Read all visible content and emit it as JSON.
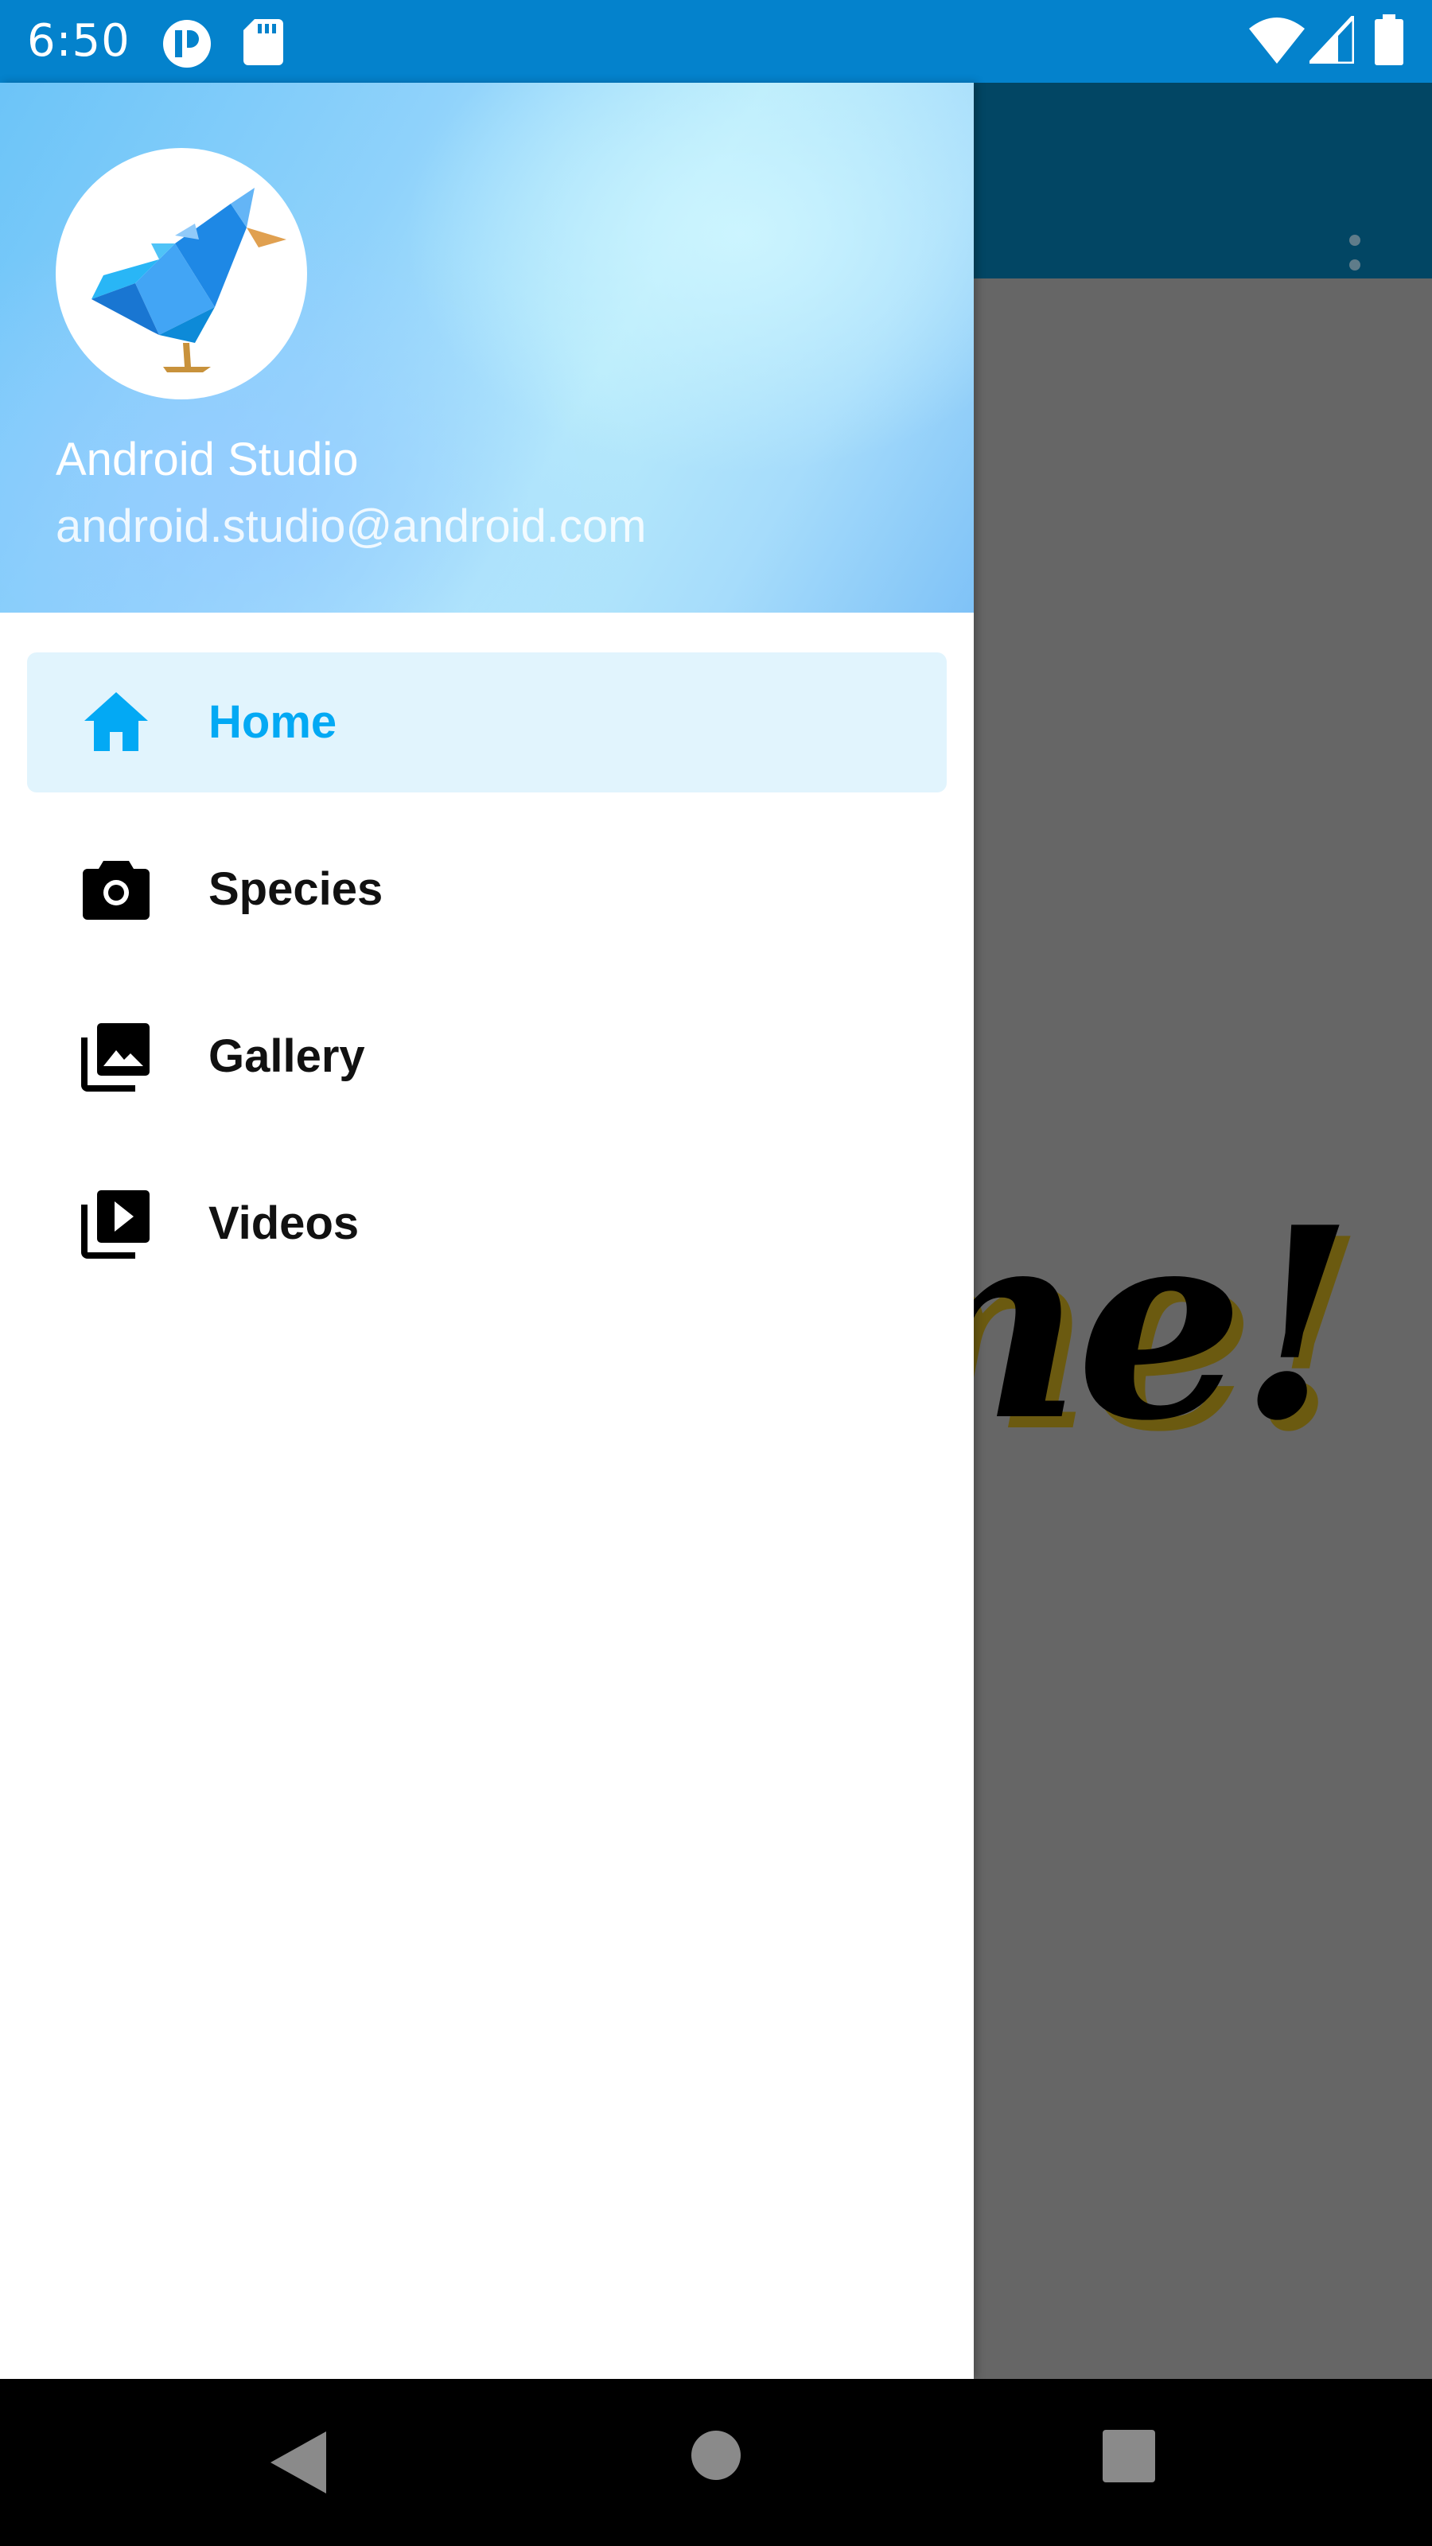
{
  "colors": {
    "status_bar": "#0482cc",
    "toolbar": "#024664",
    "accent": "#03a9f4",
    "active_item_bg": "#e1f4fd",
    "scrim": "#666666"
  },
  "status_bar": {
    "time": "6:50",
    "left_icons": [
      "notification-app-icon",
      "sd-card-icon"
    ],
    "right_icons": [
      "wifi-icon",
      "cell-signal-icon",
      "battery-icon"
    ]
  },
  "app": {
    "overflow_icon": "more-vert-icon",
    "background_text": "me!"
  },
  "drawer": {
    "header": {
      "avatar_icon": "origami-bird-icon",
      "name": "Android Studio",
      "email": "android.studio@android.com"
    },
    "items": [
      {
        "label": "Home",
        "icon": "home-icon",
        "active": true
      },
      {
        "label": "Species",
        "icon": "camera-icon",
        "active": false
      },
      {
        "label": "Gallery",
        "icon": "photo-library-icon",
        "active": false
      },
      {
        "label": "Videos",
        "icon": "video-library-icon",
        "active": false
      }
    ]
  },
  "system_nav": {
    "buttons": [
      "back-icon",
      "home-circle-icon",
      "recents-icon"
    ]
  }
}
